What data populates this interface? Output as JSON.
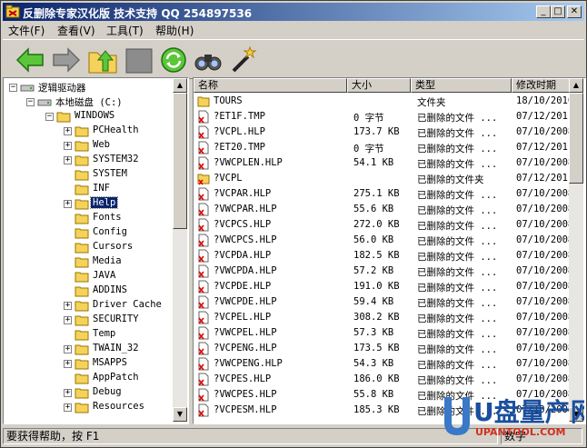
{
  "window": {
    "title": "反删除专家汉化版 技术支持 QQ 254897536"
  },
  "menu": [
    {
      "label": "文件(F)"
    },
    {
      "label": "查看(V)"
    },
    {
      "label": "工具(T)"
    },
    {
      "label": "帮助(H)"
    }
  ],
  "toolbar": {
    "buttons": [
      "back-icon",
      "forward-icon",
      "up-folder-icon",
      "blank-icon",
      "recycle-refresh-icon",
      "binoculars-icon",
      "magic-wand-icon"
    ]
  },
  "tree": {
    "items": [
      {
        "label": "逻辑驱动器",
        "level": 0,
        "expander": "-"
      },
      {
        "label": "本地磁盘 (C:)",
        "level": 1,
        "expander": "-"
      },
      {
        "label": "WINDOWS",
        "level": 2,
        "expander": "-"
      },
      {
        "label": "PCHealth",
        "level": 3,
        "expander": "+"
      },
      {
        "label": "Web",
        "level": 3,
        "expander": "+"
      },
      {
        "label": "SYSTEM32",
        "level": 3,
        "expander": "+"
      },
      {
        "label": "SYSTEM",
        "level": 3,
        "expander": ""
      },
      {
        "label": "INF",
        "level": 3,
        "expander": ""
      },
      {
        "label": "Help",
        "level": 3,
        "expander": "+",
        "selected": true
      },
      {
        "label": "Fonts",
        "level": 3,
        "expander": ""
      },
      {
        "label": "Config",
        "level": 3,
        "expander": ""
      },
      {
        "label": "Cursors",
        "level": 3,
        "expander": ""
      },
      {
        "label": "Media",
        "level": 3,
        "expander": ""
      },
      {
        "label": "JAVA",
        "level": 3,
        "expander": ""
      },
      {
        "label": "ADDINS",
        "level": 3,
        "expander": ""
      },
      {
        "label": "Driver Cache",
        "level": 3,
        "expander": "+"
      },
      {
        "label": "SECURITY",
        "level": 3,
        "expander": "+"
      },
      {
        "label": "Temp",
        "level": 3,
        "expander": ""
      },
      {
        "label": "TWAIN_32",
        "level": 3,
        "expander": "+"
      },
      {
        "label": "MSAPPS",
        "level": 3,
        "expander": "+"
      },
      {
        "label": "AppPatch",
        "level": 3,
        "expander": ""
      },
      {
        "label": "Debug",
        "level": 3,
        "expander": "+"
      },
      {
        "label": "Resources",
        "level": 3,
        "expander": "+"
      }
    ]
  },
  "list": {
    "columns": [
      "名称",
      "大小",
      "类型",
      "修改时期"
    ],
    "rows": [
      {
        "name": "TOURS",
        "size": "",
        "type": "文件夹",
        "date": "18/10/2010",
        "icon": "folder"
      },
      {
        "name": "?ET1F.TMP",
        "size": "0 字节",
        "type": "已删除的文件 ...",
        "date": "07/12/201",
        "icon": "deleted"
      },
      {
        "name": "?VCPL.HLP",
        "size": "173.7 KB",
        "type": "已删除的文件 ...",
        "date": "07/10/2008",
        "icon": "deleted"
      },
      {
        "name": "?ET20.TMP",
        "size": "0 字节",
        "type": "已删除的文件 ...",
        "date": "07/12/201",
        "icon": "deleted"
      },
      {
        "name": "?VWCPLEN.HLP",
        "size": "54.1 KB",
        "type": "已删除的文件 ...",
        "date": "07/10/2008",
        "icon": "deleted"
      },
      {
        "name": "?VCPL",
        "size": "",
        "type": "已删除的文件夹",
        "date": "07/12/201",
        "icon": "deleted-folder"
      },
      {
        "name": "?VCPAR.HLP",
        "size": "275.1 KB",
        "type": "已删除的文件 ...",
        "date": "07/10/2008",
        "icon": "deleted"
      },
      {
        "name": "?VWCPAR.HLP",
        "size": "55.6 KB",
        "type": "已删除的文件 ...",
        "date": "07/10/2008",
        "icon": "deleted"
      },
      {
        "name": "?VCPCS.HLP",
        "size": "272.0 KB",
        "type": "已删除的文件 ...",
        "date": "07/10/2008",
        "icon": "deleted"
      },
      {
        "name": "?VWCPCS.HLP",
        "size": "56.0 KB",
        "type": "已删除的文件 ...",
        "date": "07/10/2008",
        "icon": "deleted"
      },
      {
        "name": "?VCPDA.HLP",
        "size": "182.5 KB",
        "type": "已删除的文件 ...",
        "date": "07/10/2008",
        "icon": "deleted"
      },
      {
        "name": "?VWCPDA.HLP",
        "size": "57.2 KB",
        "type": "已删除的文件 ...",
        "date": "07/10/2008",
        "icon": "deleted"
      },
      {
        "name": "?VCPDE.HLP",
        "size": "191.0 KB",
        "type": "已删除的文件 ...",
        "date": "07/10/2008",
        "icon": "deleted"
      },
      {
        "name": "?VWCPDE.HLP",
        "size": "59.4 KB",
        "type": "已删除的文件 ...",
        "date": "07/10/2008",
        "icon": "deleted"
      },
      {
        "name": "?VCPEL.HLP",
        "size": "308.2 KB",
        "type": "已删除的文件 ...",
        "date": "07/10/2008",
        "icon": "deleted"
      },
      {
        "name": "?VWCPEL.HLP",
        "size": "57.3 KB",
        "type": "已删除的文件 ...",
        "date": "07/10/2008",
        "icon": "deleted"
      },
      {
        "name": "?VCPENG.HLP",
        "size": "173.5 KB",
        "type": "已删除的文件 ...",
        "date": "07/10/2008",
        "icon": "deleted"
      },
      {
        "name": "?VWCPENG.HLP",
        "size": "54.3 KB",
        "type": "已删除的文件 ...",
        "date": "07/10/2008",
        "icon": "deleted"
      },
      {
        "name": "?VCPES.HLP",
        "size": "186.0 KB",
        "type": "已删除的文件 ...",
        "date": "07/10/2008",
        "icon": "deleted"
      },
      {
        "name": "?VWCPES.HLP",
        "size": "55.8 KB",
        "type": "已删除的文件 ...",
        "date": "07/10/2008",
        "icon": "deleted"
      },
      {
        "name": "?VCPESM.HLP",
        "size": "185.3 KB",
        "type": "已删除的文件 ...",
        "date": "07/10/2008",
        "icon": "deleted"
      }
    ]
  },
  "status": {
    "help": "要获得帮助，按 F1",
    "mode": "数字"
  },
  "watermark": {
    "text": "U盘量产网",
    "url": "UPANTOOL.COM"
  }
}
